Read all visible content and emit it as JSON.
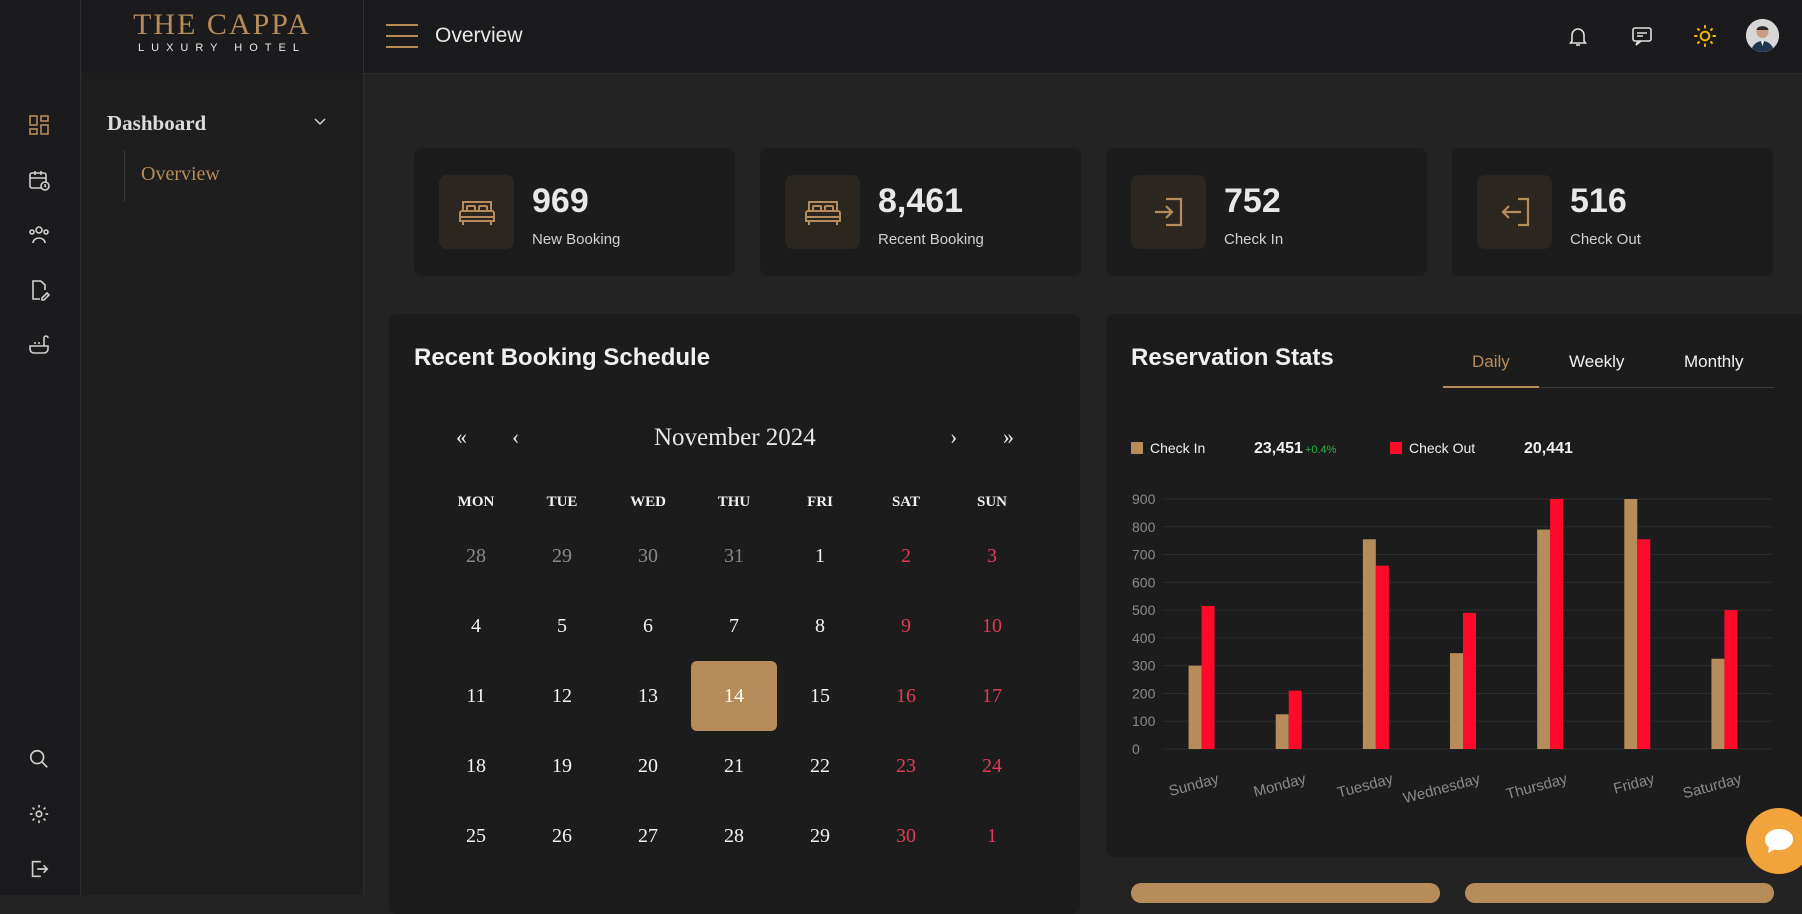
{
  "brand": {
    "name": "THE CAPPA",
    "tagline": "LUXURY HOTEL"
  },
  "rail": {
    "top_icons": [
      "dashboard-icon",
      "calendar-clock-icon",
      "users-icon",
      "edit-document-icon",
      "bathtub-icon"
    ],
    "bottom_icons": [
      "search-icon",
      "gear-icon",
      "logout-icon"
    ]
  },
  "sidebar": {
    "menu_label": "Dashboard",
    "sub_items": [
      {
        "label": "Overview"
      }
    ]
  },
  "topbar": {
    "title": "Overview",
    "icons": [
      "bell-icon",
      "message-icon",
      "sun-icon",
      "avatar"
    ],
    "accent": "#b58c5a",
    "sun_color": "#f5b800"
  },
  "stats": [
    {
      "value": "969",
      "label": "New Booking",
      "icon": "bed-icon"
    },
    {
      "value": "8,461",
      "label": "Recent Booking",
      "icon": "bed-icon"
    },
    {
      "value": "752",
      "label": "Check In",
      "icon": "login-icon"
    },
    {
      "value": "516",
      "label": "Check Out",
      "icon": "logout-icon"
    }
  ],
  "schedule": {
    "title": "Recent Booking Schedule",
    "nav": {
      "prev_year": "«",
      "prev_month": "‹",
      "next_month": "›",
      "next_year": "»"
    },
    "month": "November 2024",
    "weekdays": [
      "MON",
      "TUE",
      "WED",
      "THU",
      "FRI",
      "SAT",
      "SUN"
    ],
    "weeks": [
      [
        "28",
        "29",
        "30",
        "31",
        "1",
        "2",
        "3"
      ],
      [
        "4",
        "5",
        "6",
        "7",
        "8",
        "9",
        "10"
      ],
      [
        "11",
        "12",
        "13",
        "14",
        "15",
        "16",
        "17"
      ],
      [
        "18",
        "19",
        "20",
        "21",
        "22",
        "23",
        "24"
      ],
      [
        "25",
        "26",
        "27",
        "28",
        "29",
        "30",
        "1"
      ]
    ],
    "selected_day": "14",
    "weekend_color": "#e23a55",
    "outside_color": "#8a8a8a"
  },
  "reservation": {
    "title": "Reservation Stats",
    "tabs": [
      {
        "label": "Daily",
        "active": true
      },
      {
        "label": "Weekly",
        "active": false
      },
      {
        "label": "Monthly",
        "active": false
      }
    ],
    "legend": [
      {
        "label": "Check In",
        "value": "23,451",
        "change": "+0.4%",
        "color": "#b58c5a"
      },
      {
        "label": "Check Out",
        "value": "20,441",
        "color": "#ff0a2a"
      }
    ]
  },
  "chart_data": {
    "type": "bar",
    "categories": [
      "Sunday",
      "Monday",
      "Tuesday",
      "Wednesday",
      "Thursday",
      "Friday",
      "Saturday"
    ],
    "series": [
      {
        "name": "Check In",
        "color": "#b58c5a",
        "values": [
          300,
          125,
          755,
          345,
          790,
          900,
          325
        ]
      },
      {
        "name": "Check Out",
        "color": "#ff0a2a",
        "values": [
          515,
          210,
          660,
          490,
          900,
          755,
          500
        ]
      }
    ],
    "yticks": [
      "900",
      "800",
      "700",
      "600",
      "500",
      "400",
      "300",
      "200",
      "100",
      "0"
    ],
    "ylim": [
      0,
      900
    ],
    "grid": true,
    "legend": "top-left"
  }
}
